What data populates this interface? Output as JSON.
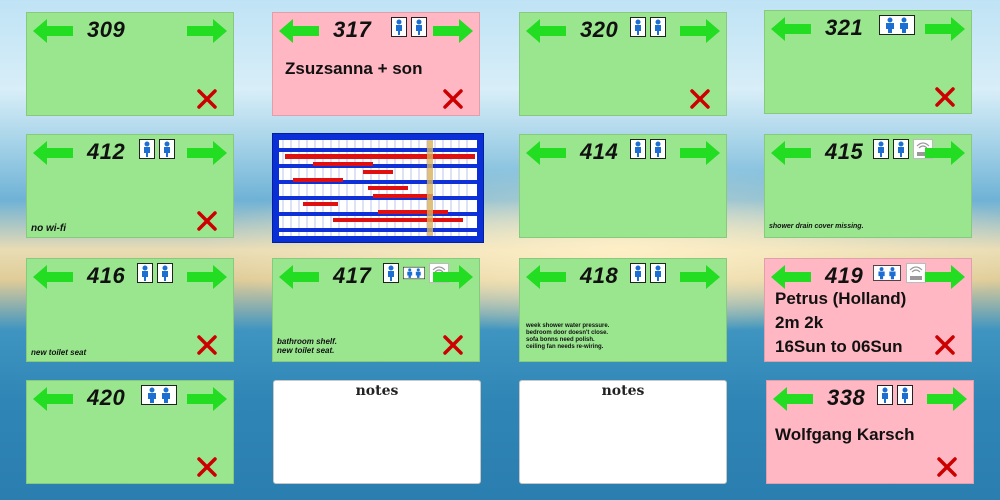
{
  "colors": {
    "green_card": "#9ae68f",
    "pink_card": "#ffb7c3",
    "arrow": "#22dd22",
    "close": "#cc0000"
  },
  "icons": {
    "nav_prev": "arrow-left-icon",
    "nav_next": "arrow-right-icon",
    "close": "close-icon",
    "guest": "person-icon",
    "guests": "two-persons-icon",
    "wifi": "wifi-router-icon"
  },
  "rooms": {
    "r309": {
      "number": "309"
    },
    "r317": {
      "number": "317",
      "guest": "Zsuzsanna + son"
    },
    "r320": {
      "number": "320"
    },
    "r321": {
      "number": "321"
    },
    "r412": {
      "number": "412",
      "note": "no wi-fi"
    },
    "r414": {
      "number": "414"
    },
    "r415": {
      "number": "415",
      "note": "shower drain cover missing."
    },
    "r416": {
      "number": "416",
      "note": "new toilet seat"
    },
    "r417": {
      "number": "417",
      "note_line1": "bathroom shelf.",
      "note_line2": "new toilet seat."
    },
    "r418": {
      "number": "418",
      "note_line1": "week shower water pressure.",
      "note_line2": "bedroom door doesn't close.",
      "note_line3": "sofa bonns need polish.",
      "note_line4": "ceiling fan needs re-wiring."
    },
    "r419": {
      "number": "419",
      "guest_line1": "Petrus  (Holland)",
      "guest_line2": "2m  2k",
      "guest_line3": "16Sun to 06Sun"
    },
    "r420": {
      "number": "420"
    },
    "r338": {
      "number": "338",
      "guest": "Wolfgang Karsch"
    }
  },
  "notes_panels": [
    {
      "title": "notes"
    },
    {
      "title": "notes"
    }
  ]
}
